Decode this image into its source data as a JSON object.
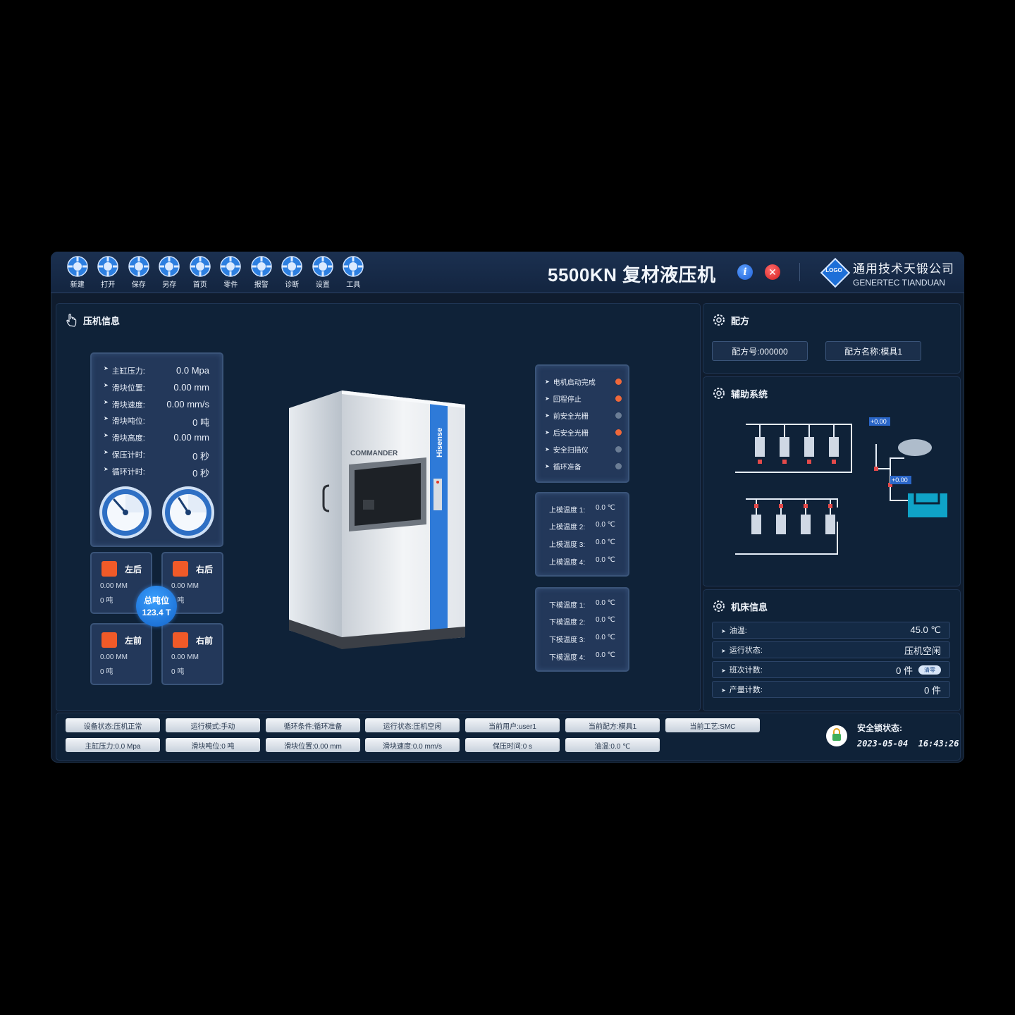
{
  "toolbar": {
    "items": [
      "新建",
      "打开",
      "保存",
      "另存",
      "首页",
      "零件",
      "报警",
      "诊断",
      "设置",
      "工具"
    ]
  },
  "header": {
    "title": "5500KN 复材液压机",
    "logo_text": "LOGO",
    "company_cn": "通用技术天锻公司",
    "company_en": "GENERTEC TIANDUAN"
  },
  "press_info": {
    "title": "压机信息",
    "rows": [
      {
        "label": "主缸压力:",
        "value": "0.0 Mpa"
      },
      {
        "label": "滑块位置:",
        "value": "0.00 mm"
      },
      {
        "label": "滑块速度:",
        "value": "0.00 mm/s"
      },
      {
        "label": "滑块吨位:",
        "value": "0 吨"
      },
      {
        "label": "滑块高度:",
        "value": "0.00 mm"
      },
      {
        "label": "保压计时:",
        "value": "0 秒"
      },
      {
        "label": "循环计时:",
        "value": "0 秒"
      }
    ],
    "corners": [
      {
        "name": "左后",
        "mm": "0.00 MM",
        "ton": "0 吨"
      },
      {
        "name": "右后",
        "mm": "0.00 MM",
        "ton": "0 吨"
      },
      {
        "name": "左前",
        "mm": "0.00 MM",
        "ton": "0 吨"
      },
      {
        "name": "右前",
        "mm": "0.00 MM",
        "ton": "0 吨"
      }
    ],
    "total_label": "总吨位",
    "total_value": "123.4 T"
  },
  "machine_image": {
    "brand_left": "COMMANDER",
    "brand_side": "Hisense"
  },
  "status_list": [
    {
      "label": "电机启动完成",
      "color": "#f0683a"
    },
    {
      "label": "回程停止",
      "color": "#f0683a"
    },
    {
      "label": "前安全光栅",
      "color": "#6b7d95"
    },
    {
      "label": "后安全光栅",
      "color": "#f0683a"
    },
    {
      "label": "安全扫描仪",
      "color": "#6b7d95"
    },
    {
      "label": "循环准备",
      "color": "#6b7d95"
    }
  ],
  "upper_temps": [
    {
      "label": "上模温度 1:",
      "value": "0.0 ℃"
    },
    {
      "label": "上模温度 2:",
      "value": "0.0 ℃"
    },
    {
      "label": "上模温度 3:",
      "value": "0.0 ℃"
    },
    {
      "label": "上模温度 4:",
      "value": "0.0 ℃"
    }
  ],
  "lower_temps": [
    {
      "label": "下模温度 1:",
      "value": "0.0 ℃"
    },
    {
      "label": "下模温度 2:",
      "value": "0.0 ℃"
    },
    {
      "label": "下模温度 3:",
      "value": "0.0 ℃"
    },
    {
      "label": "下模温度 4:",
      "value": "0.0 ℃"
    }
  ],
  "recipe": {
    "title": "配方",
    "number": "配方号:000000",
    "name": "配方名称:模具1"
  },
  "aux": {
    "title": "辅助系统",
    "pressure_1": "+0.00",
    "pressure_2": "+0.00"
  },
  "machine_info": {
    "title": "机床信息",
    "rows": [
      {
        "label": "油温:",
        "value": "45.0 ℃"
      },
      {
        "label": "运行状态:",
        "value": "压机空闲"
      },
      {
        "label": "班次计数:",
        "value": "0 件"
      },
      {
        "label": "产量计数:",
        "value": "0 件"
      }
    ],
    "clear_label": "清零"
  },
  "statusbar": {
    "row1": [
      "设备状态:压机正常",
      "运行模式:手动",
      "循环条件:循环准备",
      "运行状态:压机空闲",
      "当前用户:user1",
      "当前配方:模具1",
      "当前工艺:SMC"
    ],
    "row2": [
      "主缸压力:0.0 Mpa",
      "滑块吨位:0 吨",
      "滑块位置:0.00 mm",
      "滑块速度:0.0 mm/s",
      "保压时间:0 s",
      "油温:0.0 ℃"
    ],
    "lock_label": "安全锁状态:",
    "datetime": "2023-05-04  16:43:26"
  }
}
